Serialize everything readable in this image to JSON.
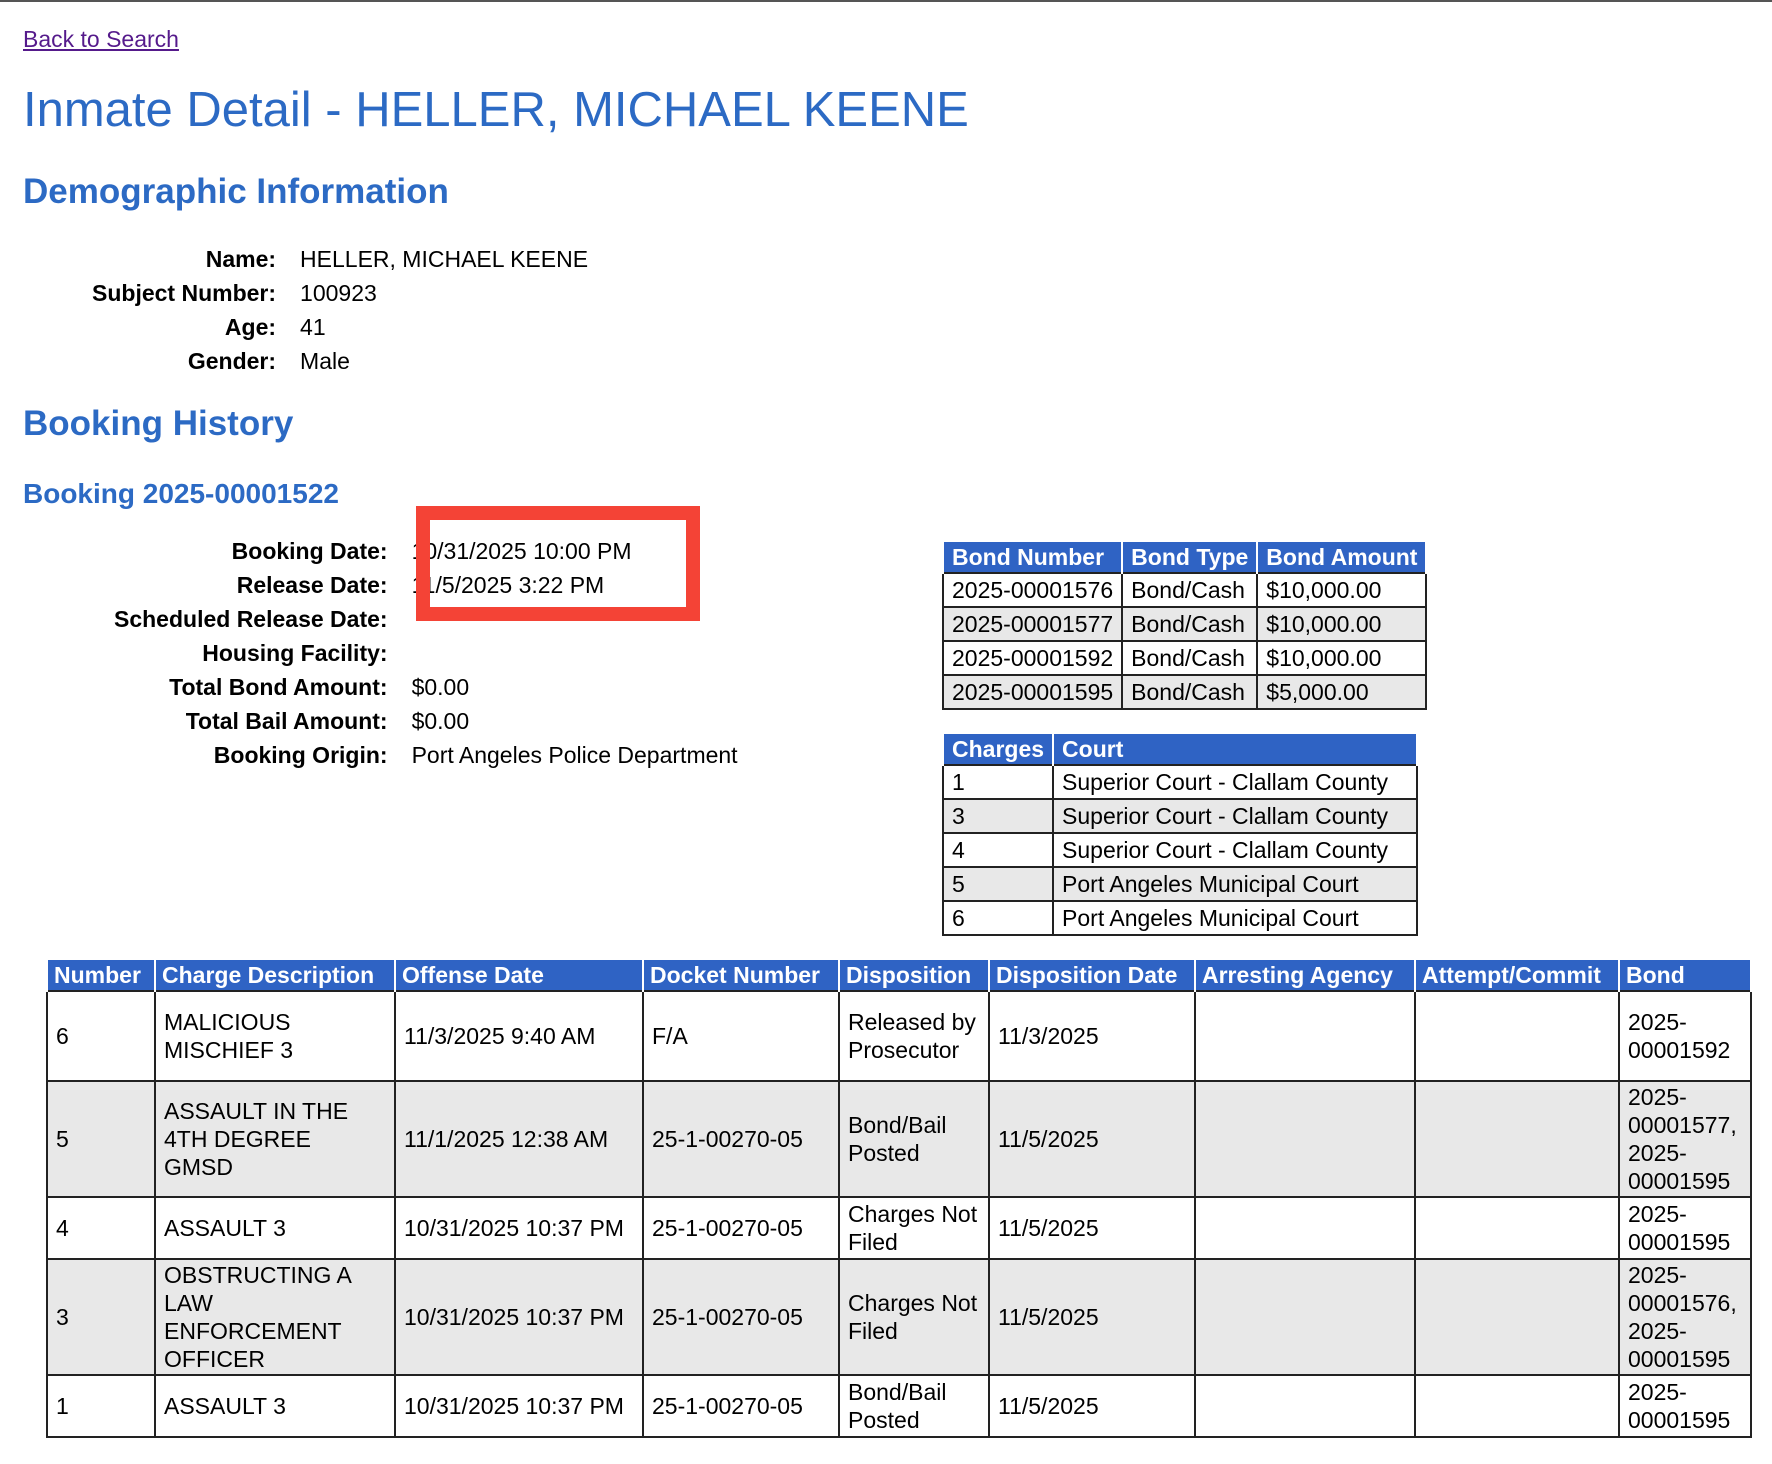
{
  "nav": {
    "back_label": "Back to Search"
  },
  "page_title": "Inmate Detail - HELLER, MICHAEL KEENE",
  "demographics": {
    "heading": "Demographic Information",
    "rows": [
      {
        "label": "Name:",
        "value": "HELLER, MICHAEL KEENE"
      },
      {
        "label": "Subject Number:",
        "value": "100923"
      },
      {
        "label": "Age:",
        "value": "41"
      },
      {
        "label": "Gender:",
        "value": "Male"
      }
    ]
  },
  "booking_history": {
    "heading": "Booking History",
    "booking_title": "Booking 2025-00001522",
    "details": [
      {
        "label": "Booking Date:",
        "value": "10/31/2025 10:00 PM"
      },
      {
        "label": "Release Date:",
        "value": "11/5/2025 3:22 PM"
      },
      {
        "label": "Scheduled Release Date:",
        "value": ""
      },
      {
        "label": "Housing Facility:",
        "value": ""
      },
      {
        "label": "Total Bond Amount:",
        "value": "$0.00"
      },
      {
        "label": "Total Bail Amount:",
        "value": "$0.00"
      },
      {
        "label": "Booking Origin:",
        "value": "Port Angeles Police Department"
      }
    ],
    "highlight_color": "#f44336"
  },
  "bonds": {
    "headers": [
      "Bond Number",
      "Bond Type",
      "Bond Amount"
    ],
    "rows": [
      [
        "2025-00001576",
        "Bond/Cash",
        "$10,000.00"
      ],
      [
        "2025-00001577",
        "Bond/Cash",
        "$10,000.00"
      ],
      [
        "2025-00001592",
        "Bond/Cash",
        "$10,000.00"
      ],
      [
        "2025-00001595",
        "Bond/Cash",
        "$5,000.00"
      ]
    ]
  },
  "courts": {
    "headers": [
      "Charges",
      "Court"
    ],
    "rows": [
      [
        "1",
        "Superior Court - Clallam County"
      ],
      [
        "3",
        "Superior Court - Clallam County"
      ],
      [
        "4",
        "Superior Court - Clallam County"
      ],
      [
        "5",
        "Port Angeles Municipal Court"
      ],
      [
        "6",
        "Port Angeles Municipal Court"
      ]
    ]
  },
  "charges": {
    "headers": [
      "Number",
      "Charge Description",
      "Offense Date",
      "Docket Number",
      "Disposition",
      "Disposition Date",
      "Arresting Agency",
      "Attempt/Commit",
      "Bond"
    ],
    "rows": [
      [
        "6",
        "MALICIOUS MISCHIEF 3",
        "11/3/2025 9:40 AM",
        "F/A",
        "Released by Prosecutor",
        "11/3/2025",
        "",
        "",
        "2025-00001592"
      ],
      [
        "5",
        "ASSAULT IN THE 4TH DEGREE GMSD",
        "11/1/2025 12:38 AM",
        "25-1-00270-05",
        "Bond/Bail Posted",
        "11/5/2025",
        "",
        "",
        "2025-00001577, 2025-00001595"
      ],
      [
        "4",
        "ASSAULT 3",
        "10/31/2025 10:37 PM",
        "25-1-00270-05",
        "Charges Not Filed",
        "11/5/2025",
        "",
        "",
        "2025-00001595"
      ],
      [
        "3",
        "OBSTRUCTING A LAW ENFORCEMENT OFFICER",
        "10/31/2025 10:37 PM",
        "25-1-00270-05",
        "Charges Not Filed",
        "11/5/2025",
        "",
        "",
        "2025-00001576, 2025-00001595"
      ],
      [
        "1",
        "ASSAULT 3",
        "10/31/2025 10:37 PM",
        "25-1-00270-05",
        "Bond/Bail Posted",
        "11/5/2025",
        "",
        "",
        "2025-00001595"
      ]
    ]
  }
}
